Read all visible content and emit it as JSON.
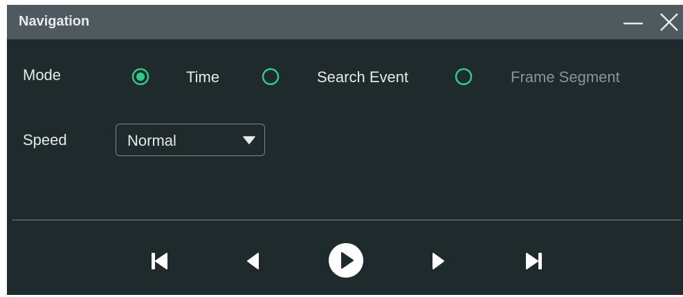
{
  "window": {
    "title": "Navigation",
    "controls": [
      "minimize-icon",
      "close-icon"
    ]
  },
  "mode": {
    "label": "Mode",
    "options": [
      {
        "label": "Time",
        "selected": true,
        "enabled": true
      },
      {
        "label": "Search Event",
        "selected": false,
        "enabled": true
      },
      {
        "label": "Frame Segment",
        "selected": false,
        "enabled": false
      }
    ]
  },
  "speed": {
    "label": "Speed",
    "value": "Normal"
  },
  "playback": {
    "buttons": [
      "skip-to-first-icon",
      "step-back-icon",
      "play-icon",
      "step-forward-icon",
      "skip-to-last-icon"
    ]
  },
  "colors": {
    "background": "#1f2a2c",
    "titlebar": "#4e5a5d",
    "accent": "#2ecc8a",
    "text": "#e6e9e9",
    "disabled_text": "#8a9496"
  }
}
